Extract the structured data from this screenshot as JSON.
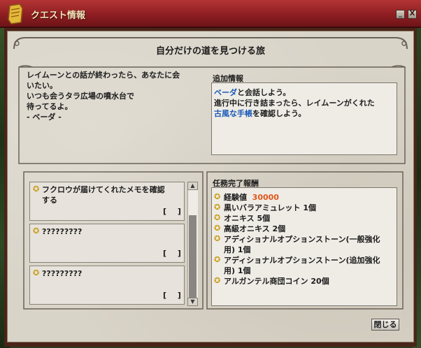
{
  "window": {
    "title": "クエスト情報",
    "minimize": "_",
    "close": "X"
  },
  "quest": {
    "name": "自分だけの道を見つける旅",
    "description_lines": [
      "レイムーンとの話が終わったら、あなたに会",
      "いたい。",
      "いつも会うタラ広場の噴水台で",
      "待ってるよ。",
      "- ベーダ -"
    ]
  },
  "additional_info": {
    "heading": "追加情報",
    "line1_link": "ベーダ",
    "line1_rest": "と会話しよう。",
    "line2": "進行中に行き詰まったら、レイムーンがくれた",
    "line3_link": "古風な手帳",
    "line3_rest": "を確認しよう。"
  },
  "tasks": [
    {
      "text_line1": "フクロウが届けてくれたメモを確認",
      "text_line2": "する",
      "bracket": "[ ]"
    },
    {
      "text_line1": "?????????",
      "text_line2": "",
      "bracket": "[ ]"
    },
    {
      "text_line1": "?????????",
      "text_line2": "",
      "bracket": "[ ]"
    }
  ],
  "rewards": {
    "heading": "任務完了報酬",
    "items": [
      {
        "label": "経験値",
        "value": "30000"
      },
      {
        "label": "黒いバラアミュレット 1個"
      },
      {
        "label": "オニキス 5個"
      },
      {
        "label": "高級オニキス 2個"
      },
      {
        "label": "アディショナルオプションストーン(一般強化",
        "label2": "用) 1個"
      },
      {
        "label": "アディショナルオプションストーン(追加強化",
        "label2": "用) 1個"
      },
      {
        "label": "アルガンテル商団コイン 20個"
      }
    ]
  },
  "footer": {
    "close_label": "閉じる"
  },
  "colors": {
    "titlebar": "#8e1e22",
    "link": "#1a5ab8",
    "exp_value": "#e0561a",
    "star": "#c89a10"
  }
}
